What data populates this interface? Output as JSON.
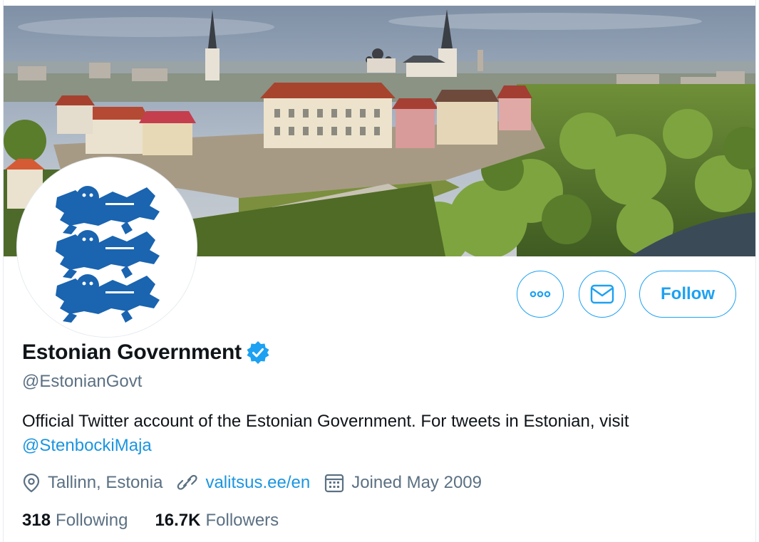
{
  "profile": {
    "display_name": "Estonian Government",
    "handle": "@EstonianGovt",
    "bio_text": "Official Twitter account of the Estonian Government. For tweets in Estonian, visit",
    "bio_mention": "@StenbockiMaja",
    "location": "Tallinn, Estonia",
    "website": "valitsus.ee/en",
    "joined": "Joined May 2009",
    "following_count": "318",
    "following_label": "Following",
    "followers_count": "16.7K",
    "followers_label": "Followers"
  },
  "actions": {
    "more_icon": "more-horizontal-icon",
    "message_icon": "envelope-icon",
    "follow_label": "Follow"
  },
  "banner": {
    "icon": "tallinn-old-town-photo"
  },
  "avatar": {
    "icon": "three-lions-coat-of-arms"
  },
  "colors": {
    "accent": "#1da1f2",
    "link": "#1b95e0",
    "secondary_text": "#5b7083",
    "primary_text": "#0f1419",
    "coat_of_arms_blue": "#1a64b0"
  }
}
